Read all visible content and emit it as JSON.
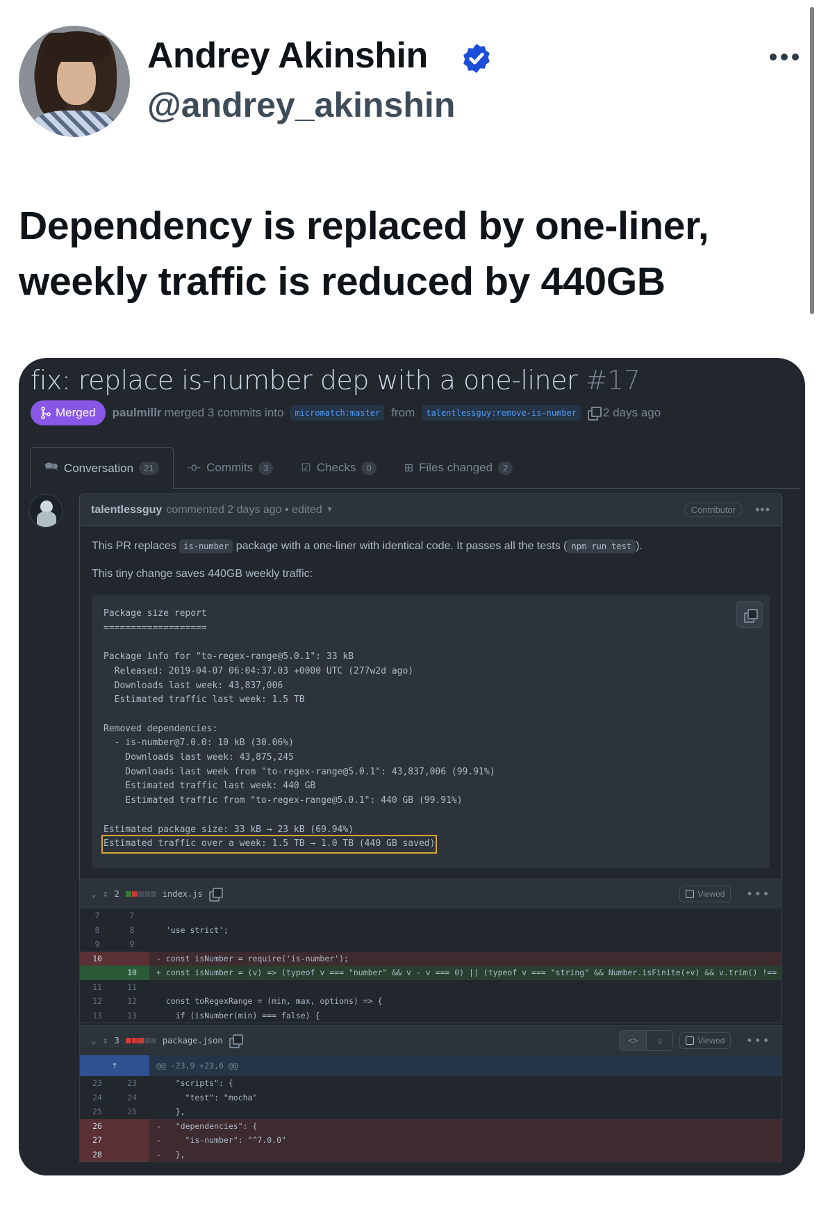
{
  "tweet": {
    "author_name": "Andrey Akinshin",
    "author_handle": "@andrey_akinshin",
    "verified": true,
    "more_icon": "ellipsis-icon",
    "text_line1": "Dependency is replaced by one-liner,",
    "text_line2": "weekly traffic is reduced by 440GB"
  },
  "pr": {
    "title": "fix: replace is-number dep with a one-liner",
    "number": "#17",
    "status": "Merged",
    "merger": "paulmillr",
    "merge_text": "merged 3 commits into",
    "base_branch": "micromatch:master",
    "from_text": "from",
    "head_branch": "talentlessguy:remove-is-number",
    "time": "2 days ago",
    "tabs": [
      {
        "label": "Conversation",
        "count": "21",
        "icon": "comment-discussion-icon"
      },
      {
        "label": "Commits",
        "count": "3",
        "icon": "git-commit-icon"
      },
      {
        "label": "Checks",
        "count": "0",
        "icon": "checklist-icon"
      },
      {
        "label": "Files changed",
        "count": "2",
        "icon": "file-diff-icon"
      }
    ]
  },
  "comment": {
    "author": "talentlessguy",
    "meta": "commented 2 days ago • edited",
    "badge": "Contributor",
    "p1_before": "This PR replaces",
    "p1_code": "is-number",
    "p1_after": "package with a one-liner with identical code. It passes all the tests (",
    "p1_code2": "npm run test",
    "p1_end": ").",
    "p2": "This tiny change saves 440GB weekly traffic:",
    "report_lines": [
      "Package size report",
      "===================",
      "",
      "Package info for \"to-regex-range@5.0.1\": 33 kB",
      "  Released: 2019-04-07 06:04:37.03 +0000 UTC (277w2d ago)",
      "  Downloads last week: 43,837,006",
      "  Estimated traffic last week: 1.5 TB",
      "",
      "Removed dependencies:",
      "  - is-number@7.0.0: 10 kB (30.06%)",
      "    Downloads last week: 43,875,245",
      "    Downloads last week from \"to-regex-range@5.0.1\": 43,837,006 (99.91%)",
      "    Estimated traffic last week: 440 GB",
      "    Estimated traffic from \"to-regex-range@5.0.1\": 440 GB (99.91%)",
      "",
      "Estimated package size: 33 kB → 23 kB (69.94%)"
    ],
    "report_highlight": "Estimated traffic over a week: 1.5 TB → 1.0 TB (440 GB saved)"
  },
  "files": [
    {
      "name": "index.js",
      "changes": "2",
      "viewed_label": "Viewed",
      "lines": [
        {
          "old": "7",
          "new": "7",
          "type": "ctx",
          "code": ""
        },
        {
          "old": "8",
          "new": "8",
          "type": "ctx",
          "code": "  'use strict';"
        },
        {
          "old": "9",
          "new": "9",
          "type": "ctx",
          "code": ""
        },
        {
          "old": "10",
          "new": "",
          "type": "del",
          "code": "- const isNumber = require('is-number');"
        },
        {
          "old": "",
          "new": "10",
          "type": "add",
          "code": "+ const isNumber = (v) => (typeof v === \"number\" && v - v === 0) || (typeof v === \"string\" && Number.isFinite(+v) && v.trim() !== \"\");"
        },
        {
          "old": "11",
          "new": "11",
          "type": "ctx",
          "code": ""
        },
        {
          "old": "12",
          "new": "12",
          "type": "ctx",
          "code": "  const toRegexRange = (min, max, options) => {"
        },
        {
          "old": "13",
          "new": "13",
          "type": "ctx",
          "code": "    if (isNumber(min) === false) {"
        }
      ]
    },
    {
      "name": "package.json",
      "changes": "3",
      "viewed_label": "Viewed",
      "hunk": "@@ -23,9 +23,6 @@",
      "lines": [
        {
          "old": "23",
          "new": "23",
          "type": "ctx",
          "code": "    \"scripts\": {"
        },
        {
          "old": "24",
          "new": "24",
          "type": "ctx",
          "code": "      \"test\": \"mocha\""
        },
        {
          "old": "25",
          "new": "25",
          "type": "ctx",
          "code": "    },"
        },
        {
          "old": "26",
          "new": "",
          "type": "del",
          "code": "-   \"dependencies\": {"
        },
        {
          "old": "27",
          "new": "",
          "type": "del",
          "code": "-     \"is-number\": \"^7.0.0\""
        },
        {
          "old": "28",
          "new": "",
          "type": "del",
          "code": "-   },"
        }
      ]
    }
  ],
  "colors": {
    "merged": "#8957e5",
    "verified": "#1d4ed8",
    "highlight_box": "#d4a72c",
    "diff_del": "#3d2b30",
    "diff_add": "#2a3f30"
  }
}
